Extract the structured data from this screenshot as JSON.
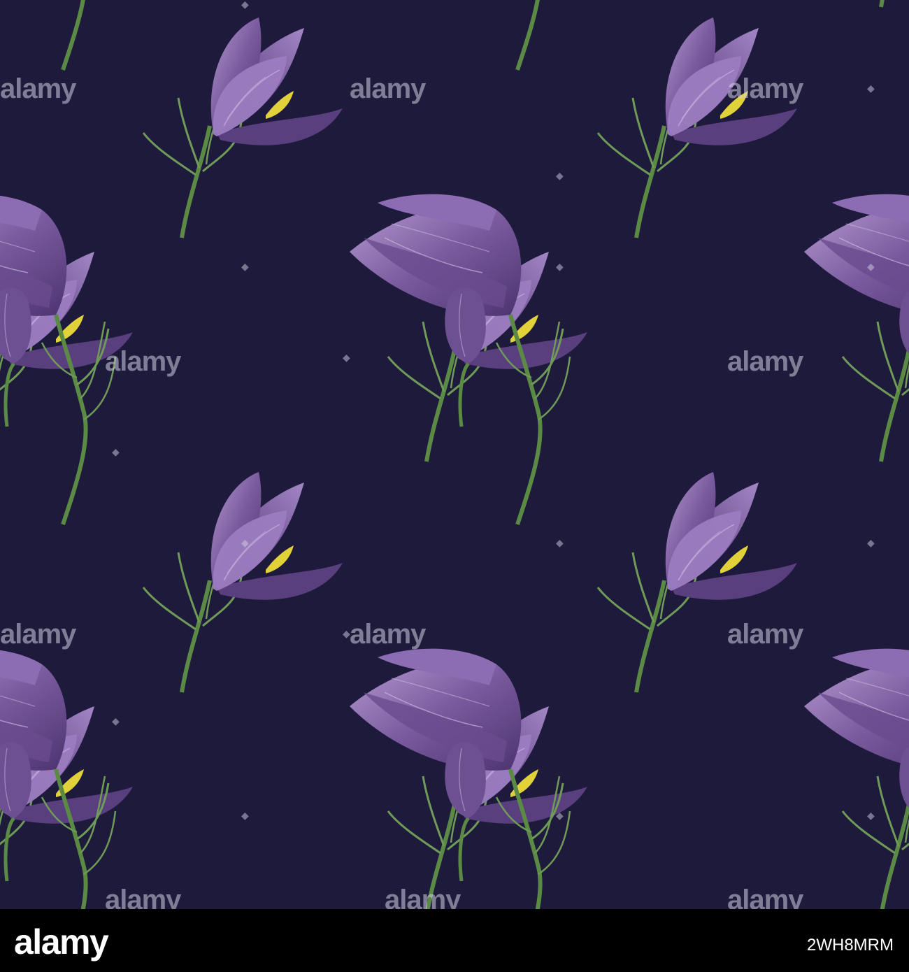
{
  "image": {
    "background_color": "#1e1a3c",
    "petal_color": "#7a5a9e",
    "petal_light": "#b49ad0",
    "petal_dark": "#4c3470",
    "stem_color": "#5b8a45",
    "anther_color": "#e2d23a",
    "motif_icons": [
      "pasque-flower-open",
      "pasque-flower-closed",
      "pasque-flower-bud"
    ]
  },
  "watermark": {
    "text": "alamy"
  },
  "footer": {
    "logo": "alamy",
    "image_id": "2WH8MRM"
  }
}
